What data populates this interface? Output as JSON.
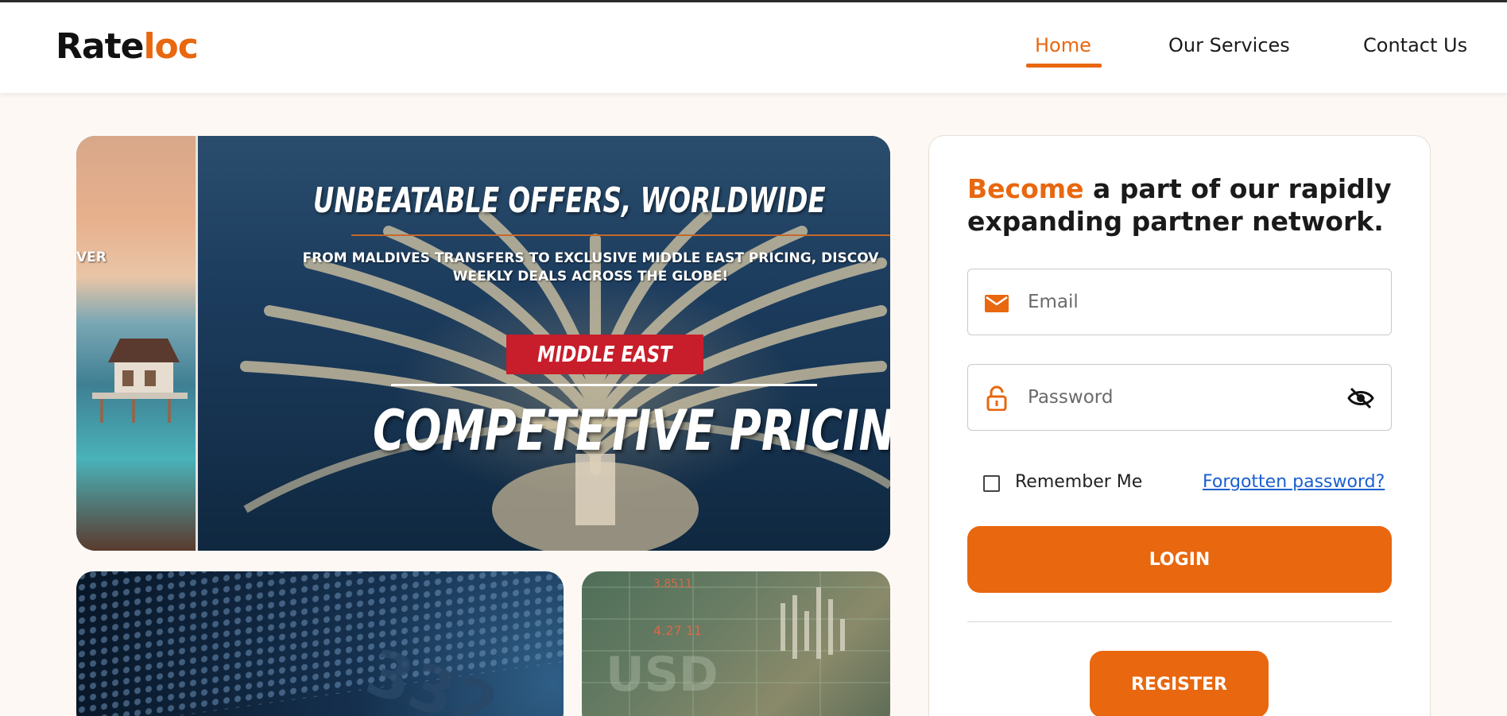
{
  "brand": {
    "logo_part1": "Rate",
    "logo_part2": "loc",
    "accent_color": "#e8670f"
  },
  "nav": {
    "items": [
      {
        "label": "Home",
        "active": true
      },
      {
        "label": "Our Services",
        "active": false
      },
      {
        "label": "Contact Us",
        "active": false
      }
    ]
  },
  "hero": {
    "title": "UNBEATABLE OFFERS, WORLDWIDE",
    "subtitle_line1": "FROM MALDIVES TRANSFERS TO EXCLUSIVE MIDDLE EAST PRICING, DISCOV",
    "subtitle_line2": "WEEKLY DEALS ACROSS THE GLOBE!",
    "previous_slide_fragment": "VER",
    "badge": "MIDDLE EAST",
    "headline": "COMPETETIVE PRICING",
    "badge_color": "#c81d2a"
  },
  "login": {
    "heading_accent": "Become",
    "heading_rest": " a part of our rapidly expanding partner network.",
    "email_placeholder": "Email",
    "password_placeholder": "Password",
    "remember_label": "Remember Me",
    "forgot_label": "Forgotten password?",
    "login_label": "LOGIN",
    "register_label": "REGISTER"
  }
}
